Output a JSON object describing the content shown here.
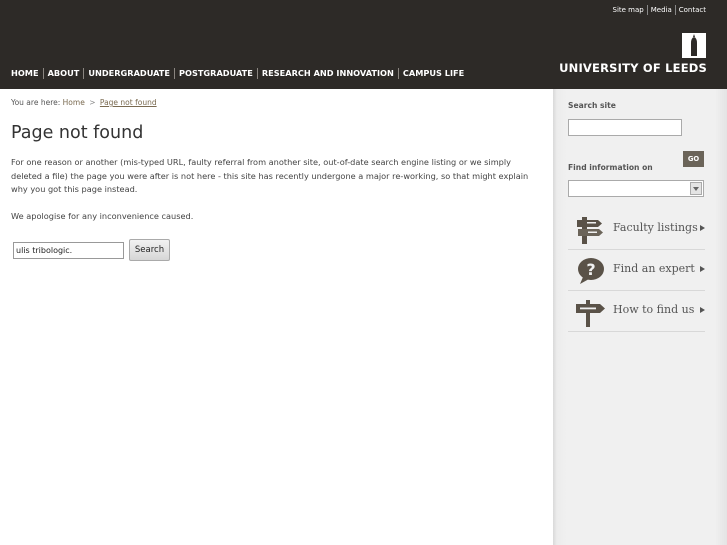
{
  "header": {
    "utility_links": [
      "Site map",
      "Media",
      "Contact"
    ],
    "university_name": "UNIVERSITY OF LEEDS",
    "nav": [
      "HOME",
      "ABOUT",
      "UNDERGRADUATE",
      "POSTGRADUATE",
      "RESEARCH AND INNOVATION",
      "CAMPUS LIFE"
    ]
  },
  "breadcrumb": {
    "prefix": "You are here:",
    "home": "Home",
    "separator": ">",
    "current": "Page not found"
  },
  "main": {
    "title": "Page not found",
    "paragraph1": "For one reason or another (mis-typed URL, faulty referral from another site, out-of-date search engine listing or we simply deleted a file) the page you were after is not here - this site has recently undergone a major re-working, so that might explain why you got this page instead.",
    "paragraph2": "We apologise for any inconvenience caused.",
    "search_value": "ulis tribologic.",
    "search_button": "Search"
  },
  "sidebar": {
    "search_label": "Search site",
    "find_label": "Find information on",
    "go_label": "GO",
    "links": [
      {
        "label": "Faculty listings",
        "icon": "signpost-icon"
      },
      {
        "label": "Find an expert",
        "icon": "question-icon"
      },
      {
        "label": "How to find us",
        "icon": "direction-sign-icon"
      }
    ]
  },
  "colors": {
    "header_bg": "#2d2a27",
    "link_brown": "#7a6a50",
    "go_button": "#6b6459",
    "sidebar_bg": "#f0f0f0"
  }
}
